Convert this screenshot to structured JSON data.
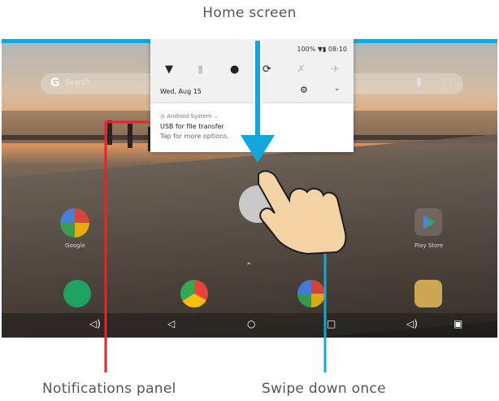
{
  "captions": {
    "title": "Home screen",
    "left": "Notifications panel",
    "right": "Swipe down once"
  },
  "colors": {
    "accent_blue": "#13a7dd",
    "callout_red": "#e8232b",
    "caption_gray": "#555555"
  },
  "search": {
    "logo": "G",
    "placeholder": "Search",
    "mic_icon": "mic-icon",
    "apps_icon": "grid-icon"
  },
  "notification_panel": {
    "status": "100% ▼▮ 08:10",
    "quick_settings": [
      "wifi-icon",
      "battery-icon",
      "dnd-icon",
      "rotate-icon",
      "bluetooth-off-icon",
      "airplane-icon"
    ],
    "date": "Wed, Aug 15",
    "notification": {
      "app": "Android System",
      "title": "USB for file transfer",
      "subtitle": "Tap for more options."
    }
  },
  "home": {
    "apps": [
      {
        "label": "Google"
      },
      {
        "label": "Play Store"
      }
    ],
    "dock": [
      "hangouts-icon",
      "chrome-icon",
      "photos-icon",
      "camera-icon"
    ]
  },
  "navbar": {
    "volume_down": "◁)",
    "back": "◁",
    "home": "○",
    "recents": "□",
    "volume_up": "◁)",
    "screenshot": "▣"
  }
}
